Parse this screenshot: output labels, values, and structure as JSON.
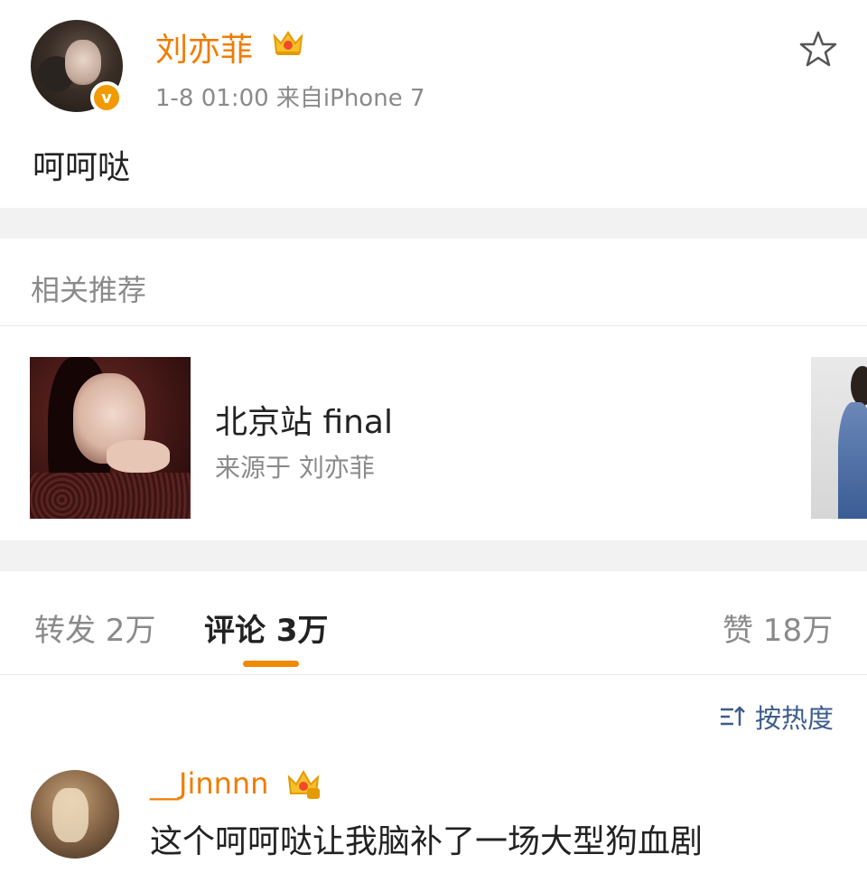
{
  "post": {
    "username": "刘亦菲",
    "meta": "1-8 01:00  来自iPhone 7",
    "verified_badge": "v",
    "text": "呵呵哒"
  },
  "recommend": {
    "title": "相关推荐",
    "card": {
      "title": "北京站 final",
      "source": "来源于 刘亦菲"
    }
  },
  "tabs": {
    "repost": "转发 2万",
    "comments": "评论 3万",
    "likes": "赞 18万"
  },
  "sort": {
    "label": "按热度"
  },
  "comment": {
    "username": "__Jinnnn",
    "text": "这个呵呵哒让我脑补了一场大型狗血剧"
  },
  "colors": {
    "accent": "#f07c00",
    "link": "#3c5c8c",
    "muted": "#8a8a8a",
    "separator": "#f2f2f2"
  },
  "icons": [
    "star-icon",
    "crown-icon",
    "sort-icon",
    "verified-icon"
  ]
}
